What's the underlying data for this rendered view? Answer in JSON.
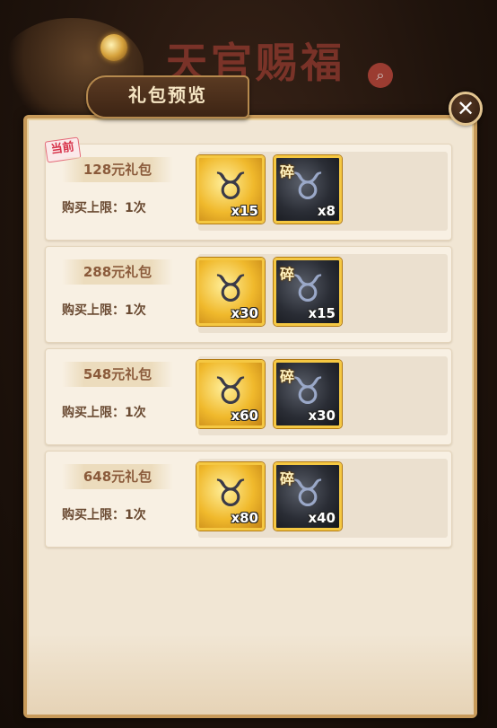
{
  "background": {
    "banner_text": "天官赐福"
  },
  "header": {
    "title": "礼包预览"
  },
  "packages": [
    {
      "tag": "当前",
      "price": "128元礼包",
      "limit": "购买上限：1次",
      "items": [
        {
          "icon": "gold-bull-icon",
          "qty": "x15",
          "frag": ""
        },
        {
          "icon": "dark-bull-fragment-icon",
          "qty": "x8",
          "frag": "碎"
        }
      ]
    },
    {
      "tag": "",
      "price": "288元礼包",
      "limit": "购买上限：1次",
      "items": [
        {
          "icon": "gold-bull-icon",
          "qty": "x30",
          "frag": ""
        },
        {
          "icon": "dark-bull-fragment-icon",
          "qty": "x15",
          "frag": "碎"
        }
      ]
    },
    {
      "tag": "",
      "price": "548元礼包",
      "limit": "购买上限：1次",
      "items": [
        {
          "icon": "gold-bull-icon",
          "qty": "x60",
          "frag": ""
        },
        {
          "icon": "dark-bull-fragment-icon",
          "qty": "x30",
          "frag": "碎"
        }
      ]
    },
    {
      "tag": "",
      "price": "648元礼包",
      "limit": "购买上限：1次",
      "items": [
        {
          "icon": "gold-bull-icon",
          "qty": "x80",
          "frag": ""
        },
        {
          "icon": "dark-bull-fragment-icon",
          "qty": "x40",
          "frag": "碎"
        }
      ]
    }
  ],
  "colors": {
    "accent_gold": "#f5c842",
    "panel": "#f1e6d4",
    "tag_red": "#d7324a"
  }
}
